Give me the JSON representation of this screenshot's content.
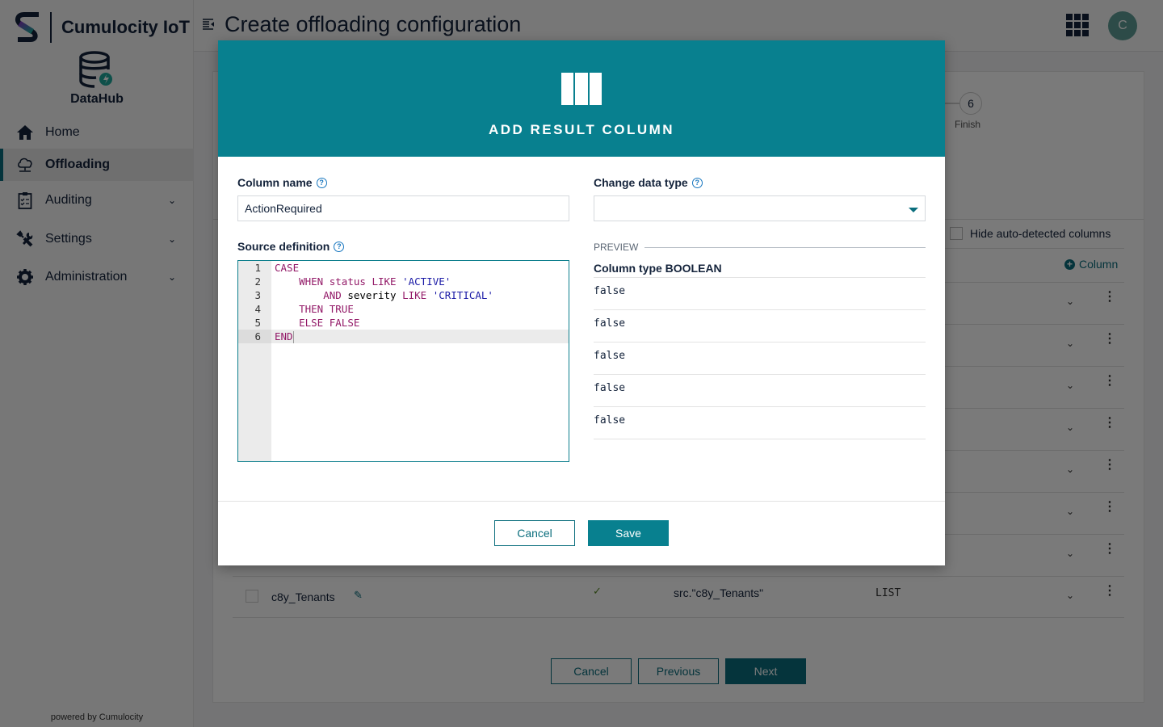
{
  "brand": {
    "name": "Cumulocity IoT"
  },
  "app": {
    "name": "DataHub"
  },
  "sidebar": {
    "items": [
      {
        "label": "Home",
        "icon": "home-icon",
        "active": false,
        "expandable": false
      },
      {
        "label": "Offloading",
        "icon": "cloud-network-icon",
        "active": true,
        "expandable": false
      },
      {
        "label": "Auditing",
        "icon": "clipboard-checklist-icon",
        "active": false,
        "expandable": true
      },
      {
        "label": "Settings",
        "icon": "tools-icon",
        "active": false,
        "expandable": true
      },
      {
        "label": "Administration",
        "icon": "gear-icon",
        "active": false,
        "expandable": true
      }
    ],
    "footer": "powered by Cumulocity"
  },
  "header": {
    "title": "Create offloading configuration",
    "avatar_initial": "C"
  },
  "background": {
    "stepper": {
      "step_number": "6",
      "step_label": "Finish"
    },
    "hide_auto_detected_label": "Hide auto-detected columns",
    "add_column_label": "Column",
    "visible_row": {
      "name": "c8y_Tenants",
      "source": "src.\"c8y_Tenants\"",
      "type": "LIST",
      "checked": true
    },
    "footer": {
      "cancel": "Cancel",
      "previous": "Previous",
      "next": "Next"
    }
  },
  "modal": {
    "title": "ADD RESULT COLUMN",
    "icon": "columns-icon",
    "column_name": {
      "label": "Column name",
      "value": "ActionRequired"
    },
    "source_definition": {
      "label": "Source definition",
      "lines": [
        {
          "n": "1",
          "tokens": [
            {
              "t": "CASE",
              "c": "kw"
            }
          ]
        },
        {
          "n": "2",
          "tokens": [
            {
              "t": "    ",
              "c": ""
            },
            {
              "t": "WHEN",
              "c": "kw"
            },
            {
              "t": " ",
              "c": ""
            },
            {
              "t": "status",
              "c": "kw"
            },
            {
              "t": " ",
              "c": ""
            },
            {
              "t": "LIKE",
              "c": "kw"
            },
            {
              "t": " ",
              "c": ""
            },
            {
              "t": "'ACTIVE'",
              "c": "str"
            }
          ]
        },
        {
          "n": "3",
          "tokens": [
            {
              "t": "        ",
              "c": ""
            },
            {
              "t": "AND",
              "c": "kw"
            },
            {
              "t": " severity ",
              "c": ""
            },
            {
              "t": "LIKE",
              "c": "kw"
            },
            {
              "t": " ",
              "c": ""
            },
            {
              "t": "'CRITICAL'",
              "c": "str"
            }
          ]
        },
        {
          "n": "4",
          "tokens": [
            {
              "t": "    ",
              "c": ""
            },
            {
              "t": "THEN",
              "c": "kw"
            },
            {
              "t": " ",
              "c": ""
            },
            {
              "t": "TRUE",
              "c": "kw"
            }
          ]
        },
        {
          "n": "5",
          "tokens": [
            {
              "t": "    ",
              "c": ""
            },
            {
              "t": "ELSE",
              "c": "kw"
            },
            {
              "t": " ",
              "c": ""
            },
            {
              "t": "FALSE",
              "c": "kw"
            }
          ]
        },
        {
          "n": "6",
          "tokens": [
            {
              "t": "END",
              "c": "kw"
            }
          ],
          "active": true
        }
      ]
    },
    "change_data_type": {
      "label": "Change data type",
      "value": ""
    },
    "preview": {
      "heading": "PREVIEW",
      "column_type": "Column type BOOLEAN",
      "values": [
        "false",
        "false",
        "false",
        "false",
        "false"
      ]
    },
    "buttons": {
      "cancel": "Cancel",
      "save": "Save"
    }
  },
  "colors": {
    "accent": "#08808f",
    "primary_button": "#0b6e7d",
    "help_icon": "#1776bf",
    "sql_keyword": "#931a68",
    "sql_string": "#1a1aa6"
  }
}
